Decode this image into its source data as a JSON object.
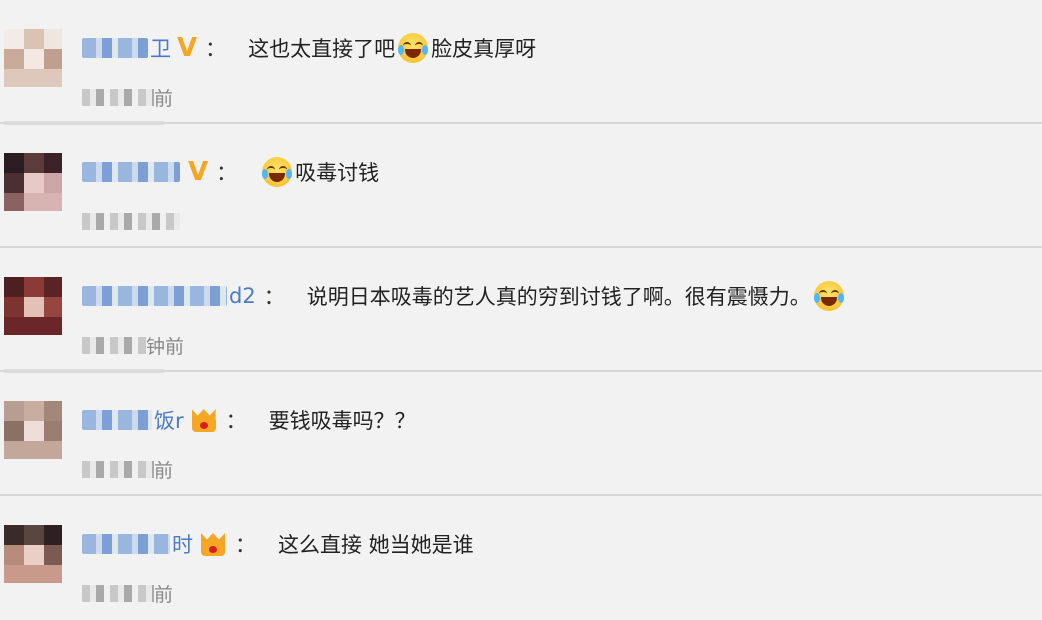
{
  "comments": [
    {
      "name_visible": "卫",
      "badge": "V",
      "badge_type": "v",
      "colon": "：",
      "text_before": "这也太直接了吧",
      "emoji": "crying-laughing",
      "text_after": "脸皮真厚呀",
      "time_visible": "前"
    },
    {
      "name_visible": "",
      "badge": "V",
      "badge_type": "v",
      "colon": "：",
      "text_before": "",
      "emoji": "tears-of-joy",
      "text_after": "吸毒讨钱",
      "time_visible": ""
    },
    {
      "name_visible": "d2",
      "badge": "",
      "badge_type": "none",
      "colon": "：",
      "text_before": "说明日本吸毒的艺人真的穷到讨钱了啊。很有震慑力。",
      "emoji": "crying-laughing",
      "text_after": "",
      "time_visible": "钟前"
    },
    {
      "name_visible": "饭r",
      "badge": "",
      "badge_type": "crown",
      "colon": "：",
      "text_before": "要钱吸毒吗？？",
      "emoji": "",
      "text_after": "",
      "time_visible": "前"
    },
    {
      "name_visible": "时",
      "badge": "",
      "badge_type": "crown",
      "colon": "：",
      "text_before": "这么直接 她当她是谁",
      "emoji": "",
      "text_after": "",
      "time_visible": "前"
    }
  ],
  "colors": {
    "background": "#f2f2f2",
    "name": "#4a7bc8",
    "badge": "#f5a623",
    "text": "#222222",
    "time": "#888888"
  }
}
